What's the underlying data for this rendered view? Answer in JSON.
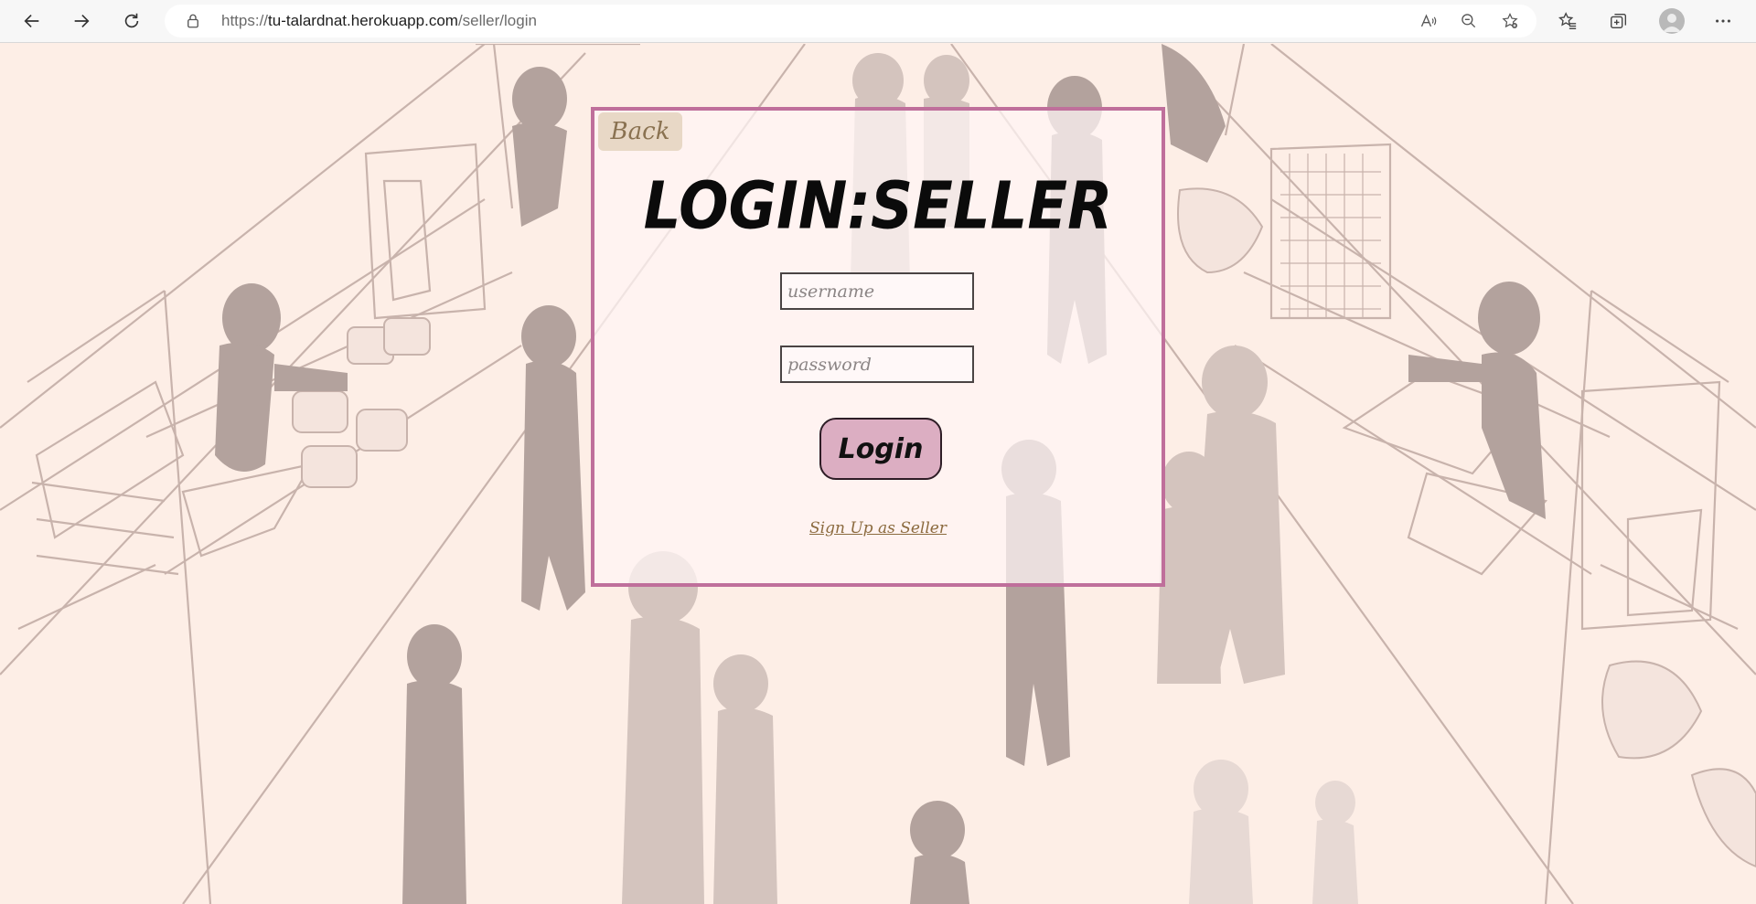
{
  "browser": {
    "url_prefix": "https://",
    "url_host": "tu-talardnat.herokuapp.com",
    "url_path": "/seller/login",
    "icons": [
      "back-arrow-icon",
      "forward-arrow-icon",
      "reload-icon",
      "lock-icon",
      "read-aloud-icon",
      "zoom-out-icon",
      "add-favorite-icon",
      "favorites-icon",
      "collections-icon",
      "profile-avatar",
      "more-options-icon"
    ]
  },
  "login": {
    "back_label": "Back",
    "title": "LOGIN:SELLER",
    "username_placeholder": "username",
    "password_placeholder": "password",
    "login_label": "Login",
    "signup_label": "Sign Up as Seller"
  },
  "colors": {
    "background": "#fdeee6",
    "card_border": "#bf6f9b",
    "login_button": "#dcaec2",
    "back_button": "#e8d8c6",
    "link": "#8b6a3e"
  }
}
